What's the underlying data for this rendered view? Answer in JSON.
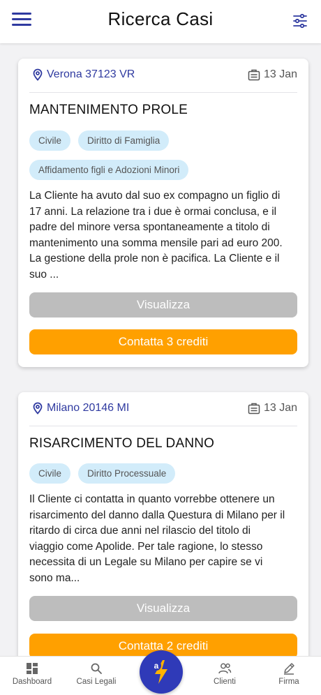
{
  "header": {
    "title": "Ricerca Casi"
  },
  "colors": {
    "brand": "#2f3aa0",
    "accent": "#ffa000",
    "tag_bg": "#d2ecfa",
    "view_button": "#bdbdbd"
  },
  "cases": [
    {
      "location": "Verona 37123 VR",
      "date": "13 Jan",
      "title": "MANTENIMENTO PROLE",
      "tags": [
        "Civile",
        "Diritto di Famiglia",
        "Affidamento figli e Adozioni Minori"
      ],
      "description_lines": [
        "La Cliente ha avuto dal suo ex compagno un figlio di",
        "17 anni. La relazione tra i due è ormai conclusa, e il",
        "padre del minore versa spontaneamente a titolo di",
        "mantenimento una somma mensile pari ad euro 200.",
        "La gestione della prole non è pacifica. La Cliente e il",
        "suo ..."
      ],
      "view_label": "Visualizza",
      "contact_label": "Contatta 3 crediti"
    },
    {
      "location": "Milano 20146 MI",
      "date": "13 Jan",
      "title": "RISARCIMENTO DEL DANNO",
      "tags": [
        "Civile",
        "Diritto Processuale"
      ],
      "description_lines": [
        "Il Cliente ci contatta in quanto vorrebbe ottenere un",
        "risarcimento del danno dalla Questura di Milano per il",
        "ritardo di circa due anni nel rilascio del titolo di",
        "viaggio come Apolide. Per tale ragione, lo stesso",
        "necessita di un Legale su Milano per capire se vi",
        "sono ma..."
      ],
      "view_label": "Visualizza",
      "contact_label": "Contatta 2 crediti"
    }
  ],
  "nav": {
    "dashboard": "Dashboard",
    "casi_legali": "Casi Legali",
    "clienti": "Clienti",
    "firma": "Firma",
    "fab_letter": "a"
  },
  "icons": {
    "menu": "hamburger-menu-icon",
    "filter": "sliders-filter-icon",
    "location": "map-pin-icon",
    "date": "briefcase-calendar-icon",
    "dashboard": "grid-dashboard-icon",
    "casi_legali": "search-icon",
    "clienti": "users-icon",
    "firma": "pen-icon",
    "fab": "lightning-bolt-icon"
  }
}
